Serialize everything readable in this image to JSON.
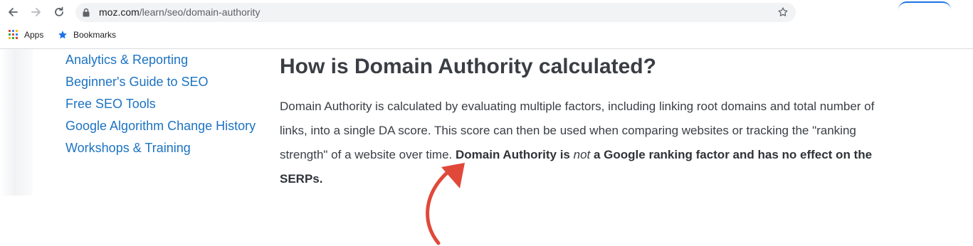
{
  "browser": {
    "url_host": "moz.com",
    "url_path": "/learn/seo/domain-authority",
    "bookmarks": [
      {
        "label": "Apps",
        "icon": "apps-grid-icon"
      },
      {
        "label": "Bookmarks",
        "icon": "star-icon"
      }
    ]
  },
  "sidebar": {
    "links": [
      {
        "label": "Analytics & Reporting"
      },
      {
        "label": "Beginner's Guide to SEO"
      },
      {
        "label": "Free SEO Tools"
      },
      {
        "label": "Google Algorithm Change History"
      },
      {
        "label": "Workshops & Training"
      }
    ]
  },
  "article": {
    "heading": "How is Domain Authority calculated?",
    "line1": "Domain Authority is calculated by evaluating multiple factors, including linking root domains and total number of",
    "line2": "links, into a single DA score. This score can then be used when comparing websites or tracking the \"ranking",
    "line3": "strength\" of a website over time.",
    "bold_a": "Domain Authority is",
    "bold_italic": "not",
    "bold_b": "a Google ranking factor and has no effect on the",
    "bold_c": "SERPs."
  },
  "colors": {
    "link": "#1c73c2",
    "text": "#3a3e44",
    "arrow": "#e0493a"
  }
}
